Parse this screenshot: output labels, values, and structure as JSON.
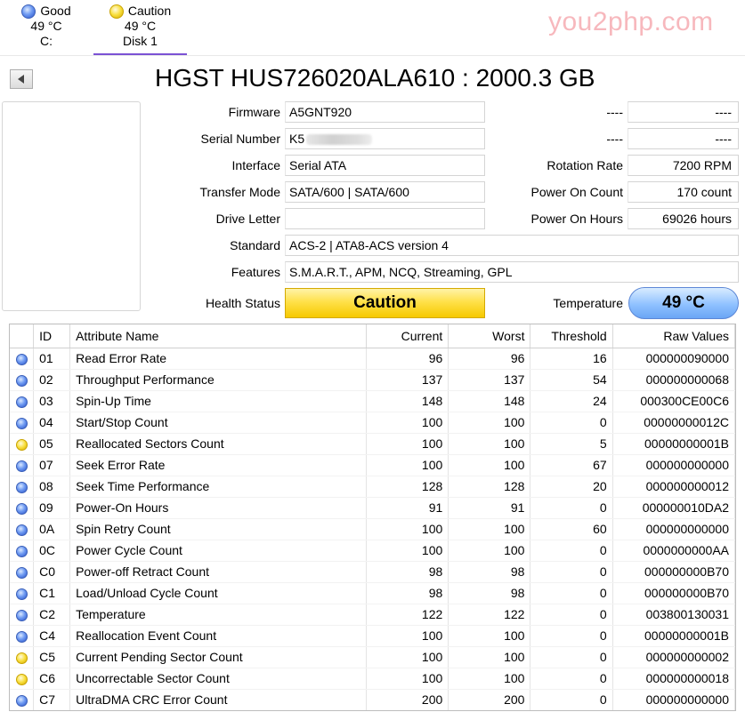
{
  "disks": [
    {
      "status": "Good",
      "temperature": "49 °C",
      "name": "C:",
      "color": "#3f6fe0",
      "active": false
    },
    {
      "status": "Caution",
      "temperature": "49 °C",
      "name": "Disk 1",
      "color": "#f2d22a",
      "active": true
    }
  ],
  "watermark": "you2php.com",
  "title": "HGST HUS726020ALA610 : 2000.3 GB",
  "info": {
    "firmware_label": "Firmware",
    "firmware": "A5GNT920",
    "serial_label": "Serial Number",
    "serial": "K5",
    "interface_label": "Interface",
    "interface": "Serial ATA",
    "transfer_label": "Transfer Mode",
    "transfer": "SATA/600 | SATA/600",
    "drive_letter_label": "Drive Letter",
    "drive_letter": "",
    "standard_label": "Standard",
    "standard": "ACS-2 | ATA8-ACS version 4",
    "features_label": "Features",
    "features": "S.M.A.R.T., APM, NCQ, Streaming, GPL",
    "health_label": "Health Status",
    "health": "Caution",
    "temperature_label": "Temperature",
    "temperature": "49 °C"
  },
  "right_info": {
    "row1_label": "----",
    "row1_value": "----",
    "row2_label": "----",
    "row2_value": "----",
    "rotation_label": "Rotation Rate",
    "rotation": "7200 RPM",
    "power_count_label": "Power On Count",
    "power_count": "170 count",
    "power_hours_label": "Power On Hours",
    "power_hours": "69026 hours"
  },
  "table": {
    "headers": {
      "id": "ID",
      "name": "Attribute Name",
      "current": "Current",
      "worst": "Worst",
      "threshold": "Threshold",
      "raw": "Raw Values"
    },
    "status_colors": {
      "good": "#3f6fe0",
      "caution": "#f2d22a"
    },
    "rows": [
      {
        "status": "good",
        "id": "01",
        "name": "Read Error Rate",
        "current": "96",
        "worst": "96",
        "threshold": "16",
        "raw": "000000090000"
      },
      {
        "status": "good",
        "id": "02",
        "name": "Throughput Performance",
        "current": "137",
        "worst": "137",
        "threshold": "54",
        "raw": "000000000068"
      },
      {
        "status": "good",
        "id": "03",
        "name": "Spin-Up Time",
        "current": "148",
        "worst": "148",
        "threshold": "24",
        "raw": "000300CE00C6"
      },
      {
        "status": "good",
        "id": "04",
        "name": "Start/Stop Count",
        "current": "100",
        "worst": "100",
        "threshold": "0",
        "raw": "00000000012C"
      },
      {
        "status": "caution",
        "id": "05",
        "name": "Reallocated Sectors Count",
        "current": "100",
        "worst": "100",
        "threshold": "5",
        "raw": "00000000001B"
      },
      {
        "status": "good",
        "id": "07",
        "name": "Seek Error Rate",
        "current": "100",
        "worst": "100",
        "threshold": "67",
        "raw": "000000000000"
      },
      {
        "status": "good",
        "id": "08",
        "name": "Seek Time Performance",
        "current": "128",
        "worst": "128",
        "threshold": "20",
        "raw": "000000000012"
      },
      {
        "status": "good",
        "id": "09",
        "name": "Power-On Hours",
        "current": "91",
        "worst": "91",
        "threshold": "0",
        "raw": "000000010DA2"
      },
      {
        "status": "good",
        "id": "0A",
        "name": "Spin Retry Count",
        "current": "100",
        "worst": "100",
        "threshold": "60",
        "raw": "000000000000"
      },
      {
        "status": "good",
        "id": "0C",
        "name": "Power Cycle Count",
        "current": "100",
        "worst": "100",
        "threshold": "0",
        "raw": "0000000000AA"
      },
      {
        "status": "good",
        "id": "C0",
        "name": "Power-off Retract Count",
        "current": "98",
        "worst": "98",
        "threshold": "0",
        "raw": "000000000B70"
      },
      {
        "status": "good",
        "id": "C1",
        "name": "Load/Unload Cycle Count",
        "current": "98",
        "worst": "98",
        "threshold": "0",
        "raw": "000000000B70"
      },
      {
        "status": "good",
        "id": "C2",
        "name": "Temperature",
        "current": "122",
        "worst": "122",
        "threshold": "0",
        "raw": "003800130031"
      },
      {
        "status": "good",
        "id": "C4",
        "name": "Reallocation Event Count",
        "current": "100",
        "worst": "100",
        "threshold": "0",
        "raw": "00000000001B"
      },
      {
        "status": "caution",
        "id": "C5",
        "name": "Current Pending Sector Count",
        "current": "100",
        "worst": "100",
        "threshold": "0",
        "raw": "000000000002"
      },
      {
        "status": "caution",
        "id": "C6",
        "name": "Uncorrectable Sector Count",
        "current": "100",
        "worst": "100",
        "threshold": "0",
        "raw": "000000000018"
      },
      {
        "status": "good",
        "id": "C7",
        "name": "UltraDMA CRC Error Count",
        "current": "200",
        "worst": "200",
        "threshold": "0",
        "raw": "000000000000"
      }
    ]
  }
}
